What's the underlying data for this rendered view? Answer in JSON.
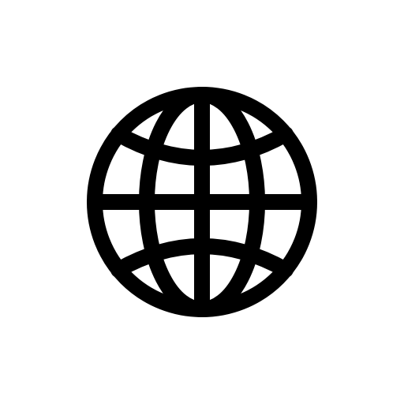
{
  "icon": {
    "name": "globe-icon",
    "color": "#000000"
  },
  "background": {
    "color": "#ffffff"
  }
}
